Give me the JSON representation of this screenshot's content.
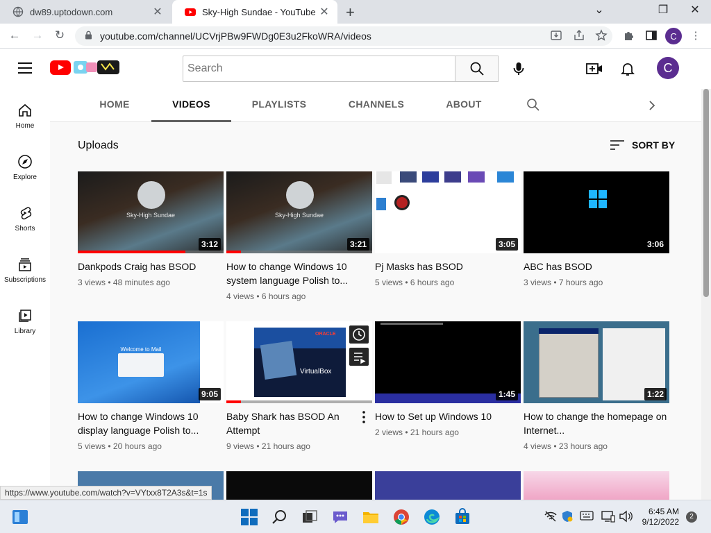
{
  "browser": {
    "tabs": [
      {
        "title": "dw89.uptodown.com",
        "close": "✕"
      },
      {
        "title": "Sky-High Sundae - YouTube",
        "close": "✕"
      }
    ],
    "new_tab": "+",
    "url": "youtube.com/channel/UCVrjPBw9FWDg0E3u2FkoWRA/videos",
    "profile_letter": "C",
    "status_url": "https://www.youtube.com/watch?v=VYtxx8T2A3s&t=1s"
  },
  "masthead": {
    "search_placeholder": "Search",
    "avatar_letter": "C"
  },
  "guide": [
    {
      "label": "Home",
      "icon": "home-icon"
    },
    {
      "label": "Explore",
      "icon": "compass-icon"
    },
    {
      "label": "Shorts",
      "icon": "shorts-icon"
    },
    {
      "label": "Subscriptions",
      "icon": "subscriptions-icon"
    },
    {
      "label": "Library",
      "icon": "library-icon"
    }
  ],
  "channel_tabs": [
    "HOME",
    "VIDEOS",
    "PLAYLISTS",
    "CHANNELS",
    "ABOUT"
  ],
  "content": {
    "section_title": "Uploads",
    "sort_label": "SORT BY"
  },
  "videos": [
    {
      "title": "Dankpods Craig has BSOD",
      "views": "3 views",
      "age": "48 minutes ago",
      "duration": "3:12",
      "thumb_caption": "Sky-High Sundae",
      "progress": 0.75
    },
    {
      "title": "How to change Windows 10 system language Polish to...",
      "views": "4 views",
      "age": "6 hours ago",
      "duration": "3:21",
      "thumb_caption": "Sky-High Sundae",
      "progress": 0.1
    },
    {
      "title": "Pj Masks has BSOD",
      "views": "5 views",
      "age": "6 hours ago",
      "duration": "3:05",
      "progress": 0
    },
    {
      "title": "ABC has BSOD",
      "views": "3 views",
      "age": "7 hours ago",
      "duration": "3:06",
      "progress": 0
    },
    {
      "title": "How to change Windows 10 display language Polish to...",
      "views": "5 views",
      "age": "20 hours ago",
      "duration": "9:05",
      "thumb_caption": "Welcome to Mail",
      "progress": 0
    },
    {
      "title": "Baby Shark has BSOD An Attempt",
      "views": "9 views",
      "age": "21 hours ago",
      "duration": "",
      "thumb_caption": "VirtualBox",
      "thumb_caption2": "ORACLE",
      "progress": 0.1
    },
    {
      "title": "How to Set up Windows 10",
      "views": "2 views",
      "age": "21 hours ago",
      "duration": "1:45",
      "progress": 0
    },
    {
      "title": "How to change the homepage on Internet...",
      "views": "4 views",
      "age": "23 hours ago",
      "duration": "1:22",
      "progress": 0
    }
  ],
  "taskbar": {
    "time": "6:45 AM",
    "date": "9/12/2022",
    "notifications": "2"
  },
  "colors": {
    "youtube_red": "#ff0000",
    "avatar_purple": "#5b2d90"
  }
}
